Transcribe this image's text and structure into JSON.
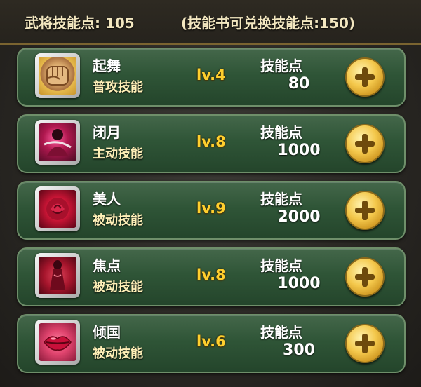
{
  "header": {
    "skill_points_label": "武将技能点: 105",
    "exchange_note": "(技能书可兑换技能点:150)"
  },
  "skills": [
    {
      "name": "起舞",
      "type": "普攻技能",
      "level": "lv.4",
      "points_label": "技能点",
      "points_value": "80",
      "icon": "fist-icon"
    },
    {
      "name": "闭月",
      "type": "主动技能",
      "level": "lv.8",
      "points_label": "技能点",
      "points_value": "1000",
      "icon": "moon-figure-icon"
    },
    {
      "name": "美人",
      "type": "被动技能",
      "level": "lv.9",
      "points_label": "技能点",
      "points_value": "2000",
      "icon": "rose-icon"
    },
    {
      "name": "焦点",
      "type": "被动技能",
      "level": "lv.8",
      "points_label": "技能点",
      "points_value": "1000",
      "icon": "red-dress-icon"
    },
    {
      "name": "倾国",
      "type": "被动技能",
      "level": "lv.6",
      "points_label": "技能点",
      "points_value": "300",
      "icon": "lips-icon"
    }
  ],
  "colors": {
    "row_green": "#2f5537",
    "level_gold": "#ffcf2e",
    "plus_gold": "#f4c84c"
  }
}
